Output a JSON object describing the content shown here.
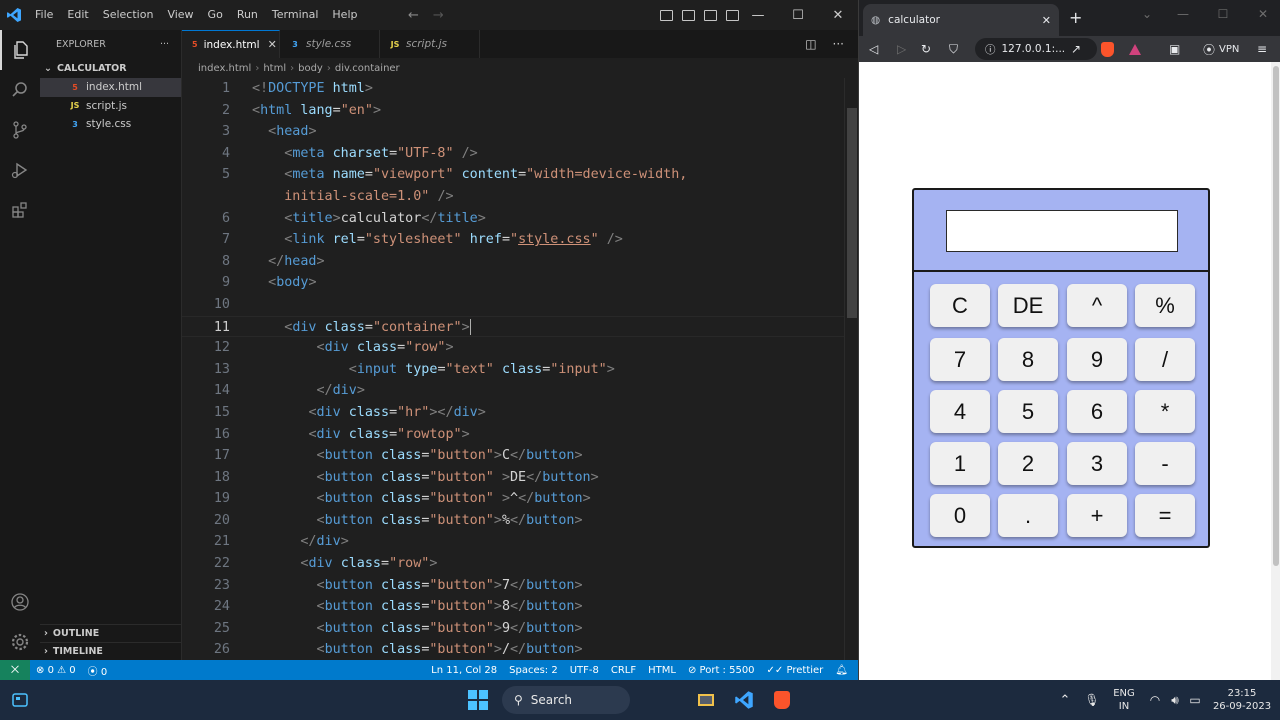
{
  "vscode": {
    "menu": [
      "File",
      "Edit",
      "Selection",
      "View",
      "Go",
      "Run",
      "Terminal",
      "Help"
    ],
    "explorer_title": "EXPLORER",
    "folder": "CALCULATOR",
    "files": [
      {
        "name": "index.html",
        "type": "html",
        "selected": true
      },
      {
        "name": "script.js",
        "type": "js",
        "selected": false
      },
      {
        "name": "style.css",
        "type": "css",
        "selected": false
      }
    ],
    "outline": "OUTLINE",
    "timeline": "TIMELINE",
    "tabs": [
      {
        "label": "index.html",
        "active": true
      },
      {
        "label": "style.css",
        "active": false
      },
      {
        "label": "script.js",
        "active": false
      }
    ],
    "breadcrumb": [
      "index.html",
      "html",
      "body",
      "div.container"
    ],
    "code_lines": [
      {
        "n": "1",
        "html": "<span class=\"t\">&lt;!</span><span class=\"tg\">DOCTYPE</span> <span class=\"at\">html</span><span class=\"t\">&gt;</span>"
      },
      {
        "n": "2",
        "html": "<span class=\"t\">&lt;</span><span class=\"tg\">html</span> <span class=\"at\">lang</span><span class=\"tx\">=</span><span class=\"st\">\"en\"</span><span class=\"t\">&gt;</span>"
      },
      {
        "n": "3",
        "html": "  <span class=\"t\">&lt;</span><span class=\"tg\">head</span><span class=\"t\">&gt;</span>"
      },
      {
        "n": "4",
        "html": "    <span class=\"t\">&lt;</span><span class=\"tg\">meta</span> <span class=\"at\">charset</span><span class=\"tx\">=</span><span class=\"st\">\"UTF-8\"</span> <span class=\"t\">/&gt;</span>"
      },
      {
        "n": "5",
        "html": "    <span class=\"t\">&lt;</span><span class=\"tg\">meta</span> <span class=\"at\">name</span><span class=\"tx\">=</span><span class=\"st\">\"viewport\"</span> <span class=\"at\">content</span><span class=\"tx\">=</span><span class=\"st\">\"width=device-width,</span>"
      },
      {
        "n": "",
        "html": "    <span class=\"st\">initial-scale=1.0\"</span> <span class=\"t\">/&gt;</span>"
      },
      {
        "n": "6",
        "html": "    <span class=\"t\">&lt;</span><span class=\"tg\">title</span><span class=\"t\">&gt;</span><span class=\"tx\">calculator</span><span class=\"t\">&lt;/</span><span class=\"tg\">title</span><span class=\"t\">&gt;</span>"
      },
      {
        "n": "7",
        "html": "    <span class=\"t\">&lt;</span><span class=\"tg\">link</span> <span class=\"at\">rel</span><span class=\"tx\">=</span><span class=\"st\">\"stylesheet\"</span> <span class=\"at\">href</span><span class=\"tx\">=</span><span class=\"st\">\"<span class=\"und\">style.css</span>\"</span> <span class=\"t\">/&gt;</span>"
      },
      {
        "n": "8",
        "html": "  <span class=\"t\">&lt;/</span><span class=\"tg\">head</span><span class=\"t\">&gt;</span>"
      },
      {
        "n": "9",
        "html": "  <span class=\"t\">&lt;</span><span class=\"tg\">body</span><span class=\"t\">&gt;</span>"
      },
      {
        "n": "10",
        "html": ""
      },
      {
        "n": "11",
        "html": "    <span class=\"t\">&lt;</span><span class=\"tg\">div</span> <span class=\"at\">class</span><span class=\"tx\">=</span><span class=\"st\">\"container\"</span><span class=\"t\">&gt;</span><span class=\"caret\"></span>",
        "current": true
      },
      {
        "n": "12",
        "html": "        <span class=\"t\">&lt;</span><span class=\"tg\">div</span> <span class=\"at\">class</span><span class=\"tx\">=</span><span class=\"st\">\"row\"</span><span class=\"t\">&gt;</span>"
      },
      {
        "n": "13",
        "html": "            <span class=\"t\">&lt;</span><span class=\"tg\">input</span> <span class=\"at\">type</span><span class=\"tx\">=</span><span class=\"st\">\"text\"</span> <span class=\"at\">class</span><span class=\"tx\">=</span><span class=\"st\">\"input\"</span><span class=\"t\">&gt;</span>"
      },
      {
        "n": "14",
        "html": "        <span class=\"t\">&lt;/</span><span class=\"tg\">div</span><span class=\"t\">&gt;</span>"
      },
      {
        "n": "15",
        "html": "       <span class=\"t\">&lt;</span><span class=\"tg\">div</span> <span class=\"at\">class</span><span class=\"tx\">=</span><span class=\"st\">\"hr\"</span><span class=\"t\">&gt;&lt;/</span><span class=\"tg\">div</span><span class=\"t\">&gt;</span>"
      },
      {
        "n": "16",
        "html": "       <span class=\"t\">&lt;</span><span class=\"tg\">div</span> <span class=\"at\">class</span><span class=\"tx\">=</span><span class=\"st\">\"rowtop\"</span><span class=\"t\">&gt;</span>"
      },
      {
        "n": "17",
        "html": "        <span class=\"t\">&lt;</span><span class=\"tg\">button</span> <span class=\"at\">class</span><span class=\"tx\">=</span><span class=\"st\">\"button\"</span><span class=\"t\">&gt;</span><span class=\"tx\">C</span><span class=\"t\">&lt;/</span><span class=\"tg\">button</span><span class=\"t\">&gt;</span>"
      },
      {
        "n": "18",
        "html": "        <span class=\"t\">&lt;</span><span class=\"tg\">button</span> <span class=\"at\">class</span><span class=\"tx\">=</span><span class=\"st\">\"button\"</span> <span class=\"t\">&gt;</span><span class=\"tx\">DE</span><span class=\"t\">&lt;/</span><span class=\"tg\">button</span><span class=\"t\">&gt;</span>"
      },
      {
        "n": "19",
        "html": "        <span class=\"t\">&lt;</span><span class=\"tg\">button</span> <span class=\"at\">class</span><span class=\"tx\">=</span><span class=\"st\">\"button\"</span> <span class=\"t\">&gt;</span><span class=\"tx\">^</span><span class=\"t\">&lt;/</span><span class=\"tg\">button</span><span class=\"t\">&gt;</span>"
      },
      {
        "n": "20",
        "html": "        <span class=\"t\">&lt;</span><span class=\"tg\">button</span> <span class=\"at\">class</span><span class=\"tx\">=</span><span class=\"st\">\"button\"</span><span class=\"t\">&gt;</span><span class=\"tx\">%</span><span class=\"t\">&lt;/</span><span class=\"tg\">button</span><span class=\"t\">&gt;</span>"
      },
      {
        "n": "21",
        "html": "      <span class=\"t\">&lt;/</span><span class=\"tg\">div</span><span class=\"t\">&gt;</span>"
      },
      {
        "n": "22",
        "html": "      <span class=\"t\">&lt;</span><span class=\"tg\">div</span> <span class=\"at\">class</span><span class=\"tx\">=</span><span class=\"st\">\"row\"</span><span class=\"t\">&gt;</span>"
      },
      {
        "n": "23",
        "html": "        <span class=\"t\">&lt;</span><span class=\"tg\">button</span> <span class=\"at\">class</span><span class=\"tx\">=</span><span class=\"st\">\"button\"</span><span class=\"t\">&gt;</span><span class=\"tx\">7</span><span class=\"t\">&lt;/</span><span class=\"tg\">button</span><span class=\"t\">&gt;</span>"
      },
      {
        "n": "24",
        "html": "        <span class=\"t\">&lt;</span><span class=\"tg\">button</span> <span class=\"at\">class</span><span class=\"tx\">=</span><span class=\"st\">\"button\"</span><span class=\"t\">&gt;</span><span class=\"tx\">8</span><span class=\"t\">&lt;/</span><span class=\"tg\">button</span><span class=\"t\">&gt;</span>"
      },
      {
        "n": "25",
        "html": "        <span class=\"t\">&lt;</span><span class=\"tg\">button</span> <span class=\"at\">class</span><span class=\"tx\">=</span><span class=\"st\">\"button\"</span><span class=\"t\">&gt;</span><span class=\"tx\">9</span><span class=\"t\">&lt;/</span><span class=\"tg\">button</span><span class=\"t\">&gt;</span>"
      },
      {
        "n": "26",
        "html": "        <span class=\"t\">&lt;</span><span class=\"tg\">button</span> <span class=\"at\">class</span><span class=\"tx\">=</span><span class=\"st\">\"button\"</span><span class=\"t\">&gt;</span><span class=\"tx\">/</span><span class=\"t\">&lt;/</span><span class=\"tg\">button</span><span class=\"t\">&gt;</span>"
      }
    ],
    "status": {
      "errors": "0",
      "warnings": "0",
      "ports": "0",
      "position": "Ln 11, Col 28",
      "spaces": "Spaces: 2",
      "encoding": "UTF-8",
      "eol": "CRLF",
      "language": "HTML",
      "port": "Port : 5500",
      "prettier": "Prettier"
    }
  },
  "browser": {
    "tab_title": "calculator",
    "url": "127.0.0.1:...",
    "vpn": "VPN",
    "calculator": {
      "buttons": [
        [
          "C",
          "DE",
          "^",
          "%"
        ],
        [
          "7",
          "8",
          "9",
          "/"
        ],
        [
          "4",
          "5",
          "6",
          "*"
        ],
        [
          "1",
          "2",
          "3",
          "-"
        ],
        [
          "0",
          ".",
          "+",
          "="
        ]
      ]
    }
  },
  "taskbar": {
    "search": "Search",
    "lang_top": "ENG",
    "lang_bottom": "IN",
    "time": "23:15",
    "date": "26-09-2023"
  }
}
